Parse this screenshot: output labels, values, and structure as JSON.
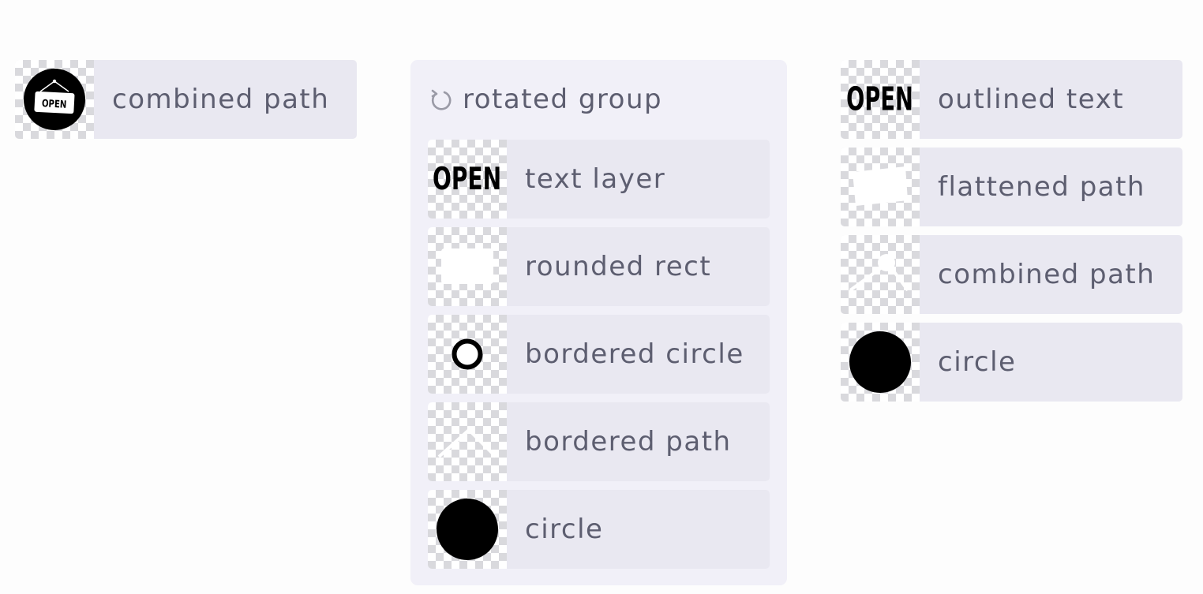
{
  "left_panel": {
    "items": [
      {
        "label": "combined path",
        "icon": "open-sign-icon"
      }
    ]
  },
  "group": {
    "label": "rotated group",
    "icon": "rotate-icon",
    "items": [
      {
        "label": "text layer",
        "icon": "text-open-icon",
        "thumb_text": "OPEN"
      },
      {
        "label": "rounded rect",
        "icon": "rounded-rect-icon"
      },
      {
        "label": "bordered circle",
        "icon": "bordered-circle-icon"
      },
      {
        "label": "bordered path",
        "icon": "chevron-path-icon"
      },
      {
        "label": "circle",
        "icon": "circle-icon"
      }
    ]
  },
  "right_panel": {
    "items": [
      {
        "label": "outlined text",
        "icon": "outlined-text-icon",
        "thumb_text": "OPEN"
      },
      {
        "label": "flattened path",
        "icon": "flattened-rect-icon"
      },
      {
        "label": "combined path",
        "icon": "combined-path-icon"
      },
      {
        "label": "circle",
        "icon": "circle-icon"
      }
    ]
  },
  "open_sign_text": "OPEN",
  "colors": {
    "row_bg": "#e9e8f1",
    "group_bg": "#f1f0f8",
    "label": "#5d5e70",
    "icon_gray": "#9a9aa6"
  }
}
